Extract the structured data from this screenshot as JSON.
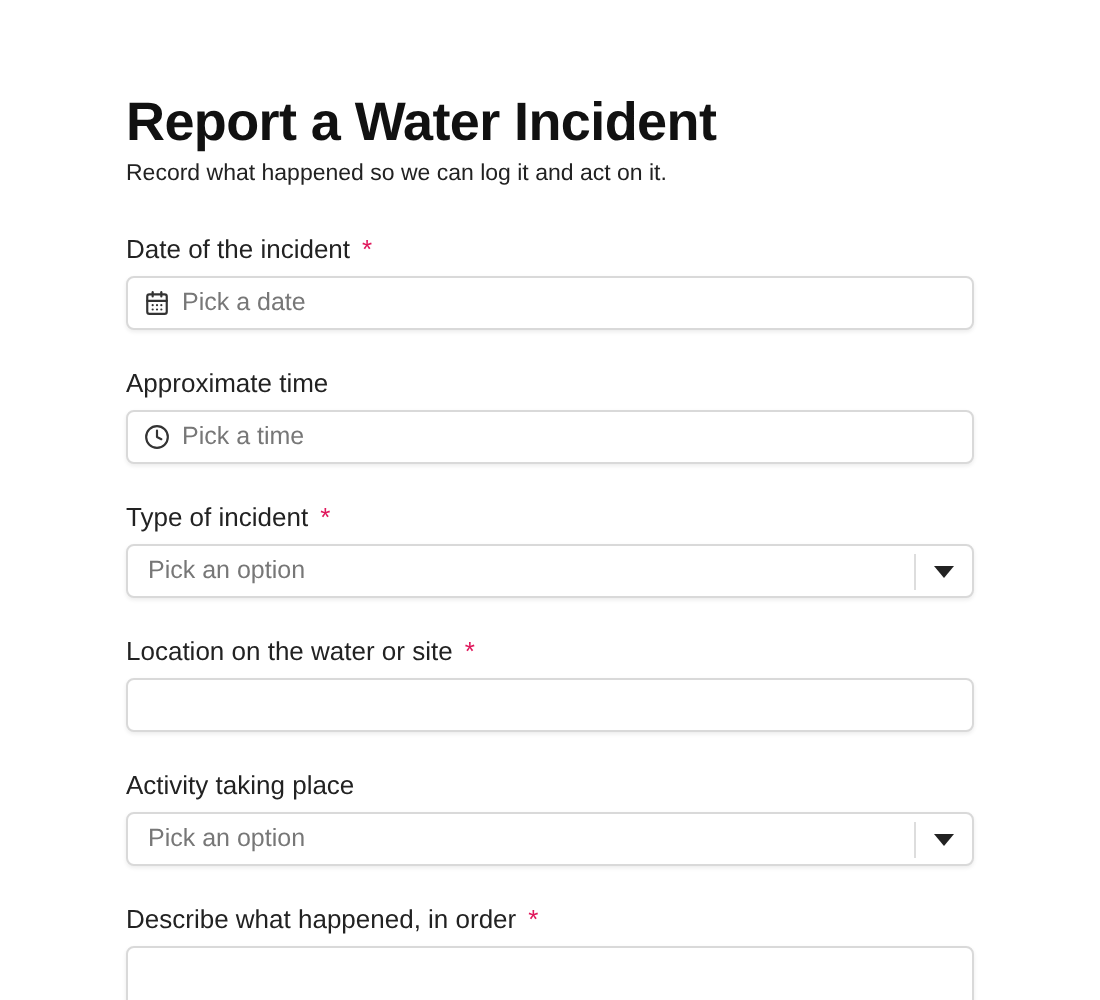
{
  "title": "Report a Water Incident",
  "subtitle": "Record what happened so we can log it and act on it.",
  "required_mark": "*",
  "fields": [
    {
      "label": "Date of the incident",
      "required": true,
      "kind": "date",
      "placeholder": "Pick a date"
    },
    {
      "label": "Approximate time",
      "required": false,
      "kind": "time",
      "placeholder": "Pick a time"
    },
    {
      "label": "Type of incident",
      "required": true,
      "kind": "select",
      "placeholder": "Pick an option"
    },
    {
      "label": "Location on the water or site",
      "required": true,
      "kind": "text"
    },
    {
      "label": "Activity taking place",
      "required": false,
      "kind": "select",
      "placeholder": "Pick an option"
    },
    {
      "label": "Describe what happened, in order",
      "required": true,
      "kind": "textarea"
    }
  ]
}
